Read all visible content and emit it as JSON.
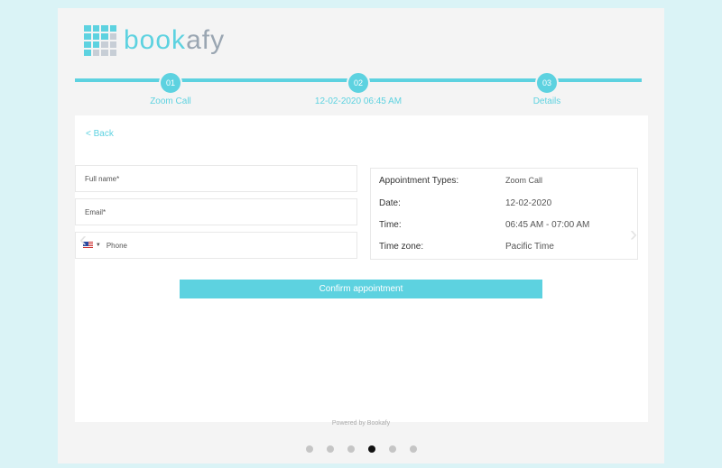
{
  "brand": {
    "name_part1": "book",
    "name_part2": "afy",
    "accent": "#5dd2e0"
  },
  "steps": [
    {
      "num": "01",
      "label": "Zoom Call"
    },
    {
      "num": "02",
      "label": "12-02-2020 06:45 AM"
    },
    {
      "num": "03",
      "label": "Details"
    }
  ],
  "back_label": "< Back",
  "form": {
    "full_name_placeholder": "Full name*",
    "email_placeholder": "Email*",
    "phone_placeholder": "Phone",
    "phone_caret": "▼"
  },
  "summary": {
    "type_label": "Appointment Types:",
    "type_value": "Zoom Call",
    "date_label": "Date:",
    "date_value": "12-02-2020",
    "time_label": "Time:",
    "time_value": "06:45 AM - 07:00 AM",
    "tz_label": "Time zone:",
    "tz_value": "Pacific Time"
  },
  "confirm_label": "Confirm appointment",
  "powered_by": "Powered by Bookafy",
  "carousel": {
    "count": 6,
    "active_index": 3
  },
  "icons": {
    "prev": "chevron-left-icon",
    "next": "chevron-right-icon",
    "flag": "us-flag-icon"
  }
}
